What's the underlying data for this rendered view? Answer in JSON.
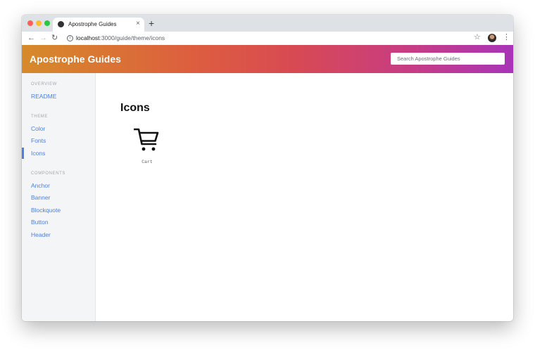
{
  "browser": {
    "tab_title": "Apostrophe Guides",
    "tab_close": "×",
    "new_tab": "+",
    "url_host": "localhost",
    "url_path": ":3000/guide/theme/icons"
  },
  "header": {
    "brand": "Apostrophe Guides",
    "search_placeholder": "Search Apostrophe Guides",
    "gradient": [
      "#d68a2a",
      "#dd5e3f",
      "#d84a52",
      "#c63c86",
      "#a834b8"
    ]
  },
  "sidebar": {
    "sections": [
      {
        "title": "OVERVIEW",
        "items": [
          "README"
        ]
      },
      {
        "title": "THEME",
        "items": [
          "Color",
          "Fonts",
          "Icons"
        ]
      },
      {
        "title": "COMPONENTS",
        "items": [
          "Anchor",
          "Banner",
          "Blockquote",
          "Button",
          "Header"
        ]
      }
    ],
    "active_item": "Icons",
    "link_color": "#4a7fe5"
  },
  "main": {
    "title": "Icons",
    "icons": [
      {
        "name": "cart-icon",
        "caption": "Cart"
      }
    ]
  }
}
